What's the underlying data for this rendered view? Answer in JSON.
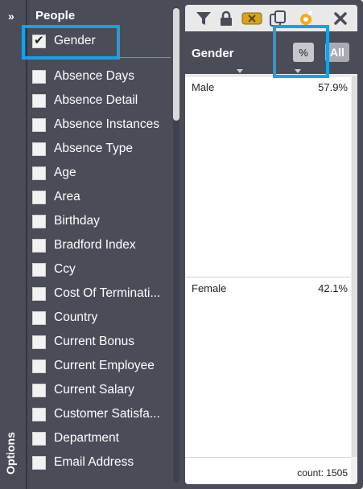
{
  "rail": {
    "expand_glyph": "»",
    "options_label": "Options"
  },
  "field_panel": {
    "header": "People",
    "selected": [
      {
        "label": "Gender",
        "checked": true
      }
    ],
    "items": [
      {
        "label": "Absence Days",
        "checked": false
      },
      {
        "label": "Absence Detail",
        "checked": false
      },
      {
        "label": "Absence Instances",
        "checked": false
      },
      {
        "label": "Absence Type",
        "checked": false
      },
      {
        "label": "Age",
        "checked": false
      },
      {
        "label": "Area",
        "checked": false
      },
      {
        "label": "Birthday",
        "checked": false
      },
      {
        "label": "Bradford Index",
        "checked": false
      },
      {
        "label": "Ccy",
        "checked": false
      },
      {
        "label": "Cost Of Terminati...",
        "checked": false
      },
      {
        "label": "Country",
        "checked": false
      },
      {
        "label": "Current Bonus",
        "checked": false
      },
      {
        "label": "Current Employee",
        "checked": false
      },
      {
        "label": "Current Salary",
        "checked": false
      },
      {
        "label": "Customer Satisfa...",
        "checked": false
      },
      {
        "label": "Department",
        "checked": false
      },
      {
        "label": "Email Address",
        "checked": false
      }
    ]
  },
  "card": {
    "toolbar_icons": [
      "filter-icon",
      "lock-icon",
      "clear-icon",
      "copy-icon",
      "link-icon",
      "close-icon"
    ],
    "title": "Gender",
    "percent_button": "%",
    "all_button": "All",
    "rows": [
      {
        "label": "Male",
        "value": "57.9%"
      },
      {
        "label": "Female",
        "value": "42.1%"
      }
    ],
    "footer": "count: 1505"
  },
  "colors": {
    "panel": "#4a4d58",
    "highlight": "#1aa0e6",
    "card_bg": "#f0f0f0"
  }
}
